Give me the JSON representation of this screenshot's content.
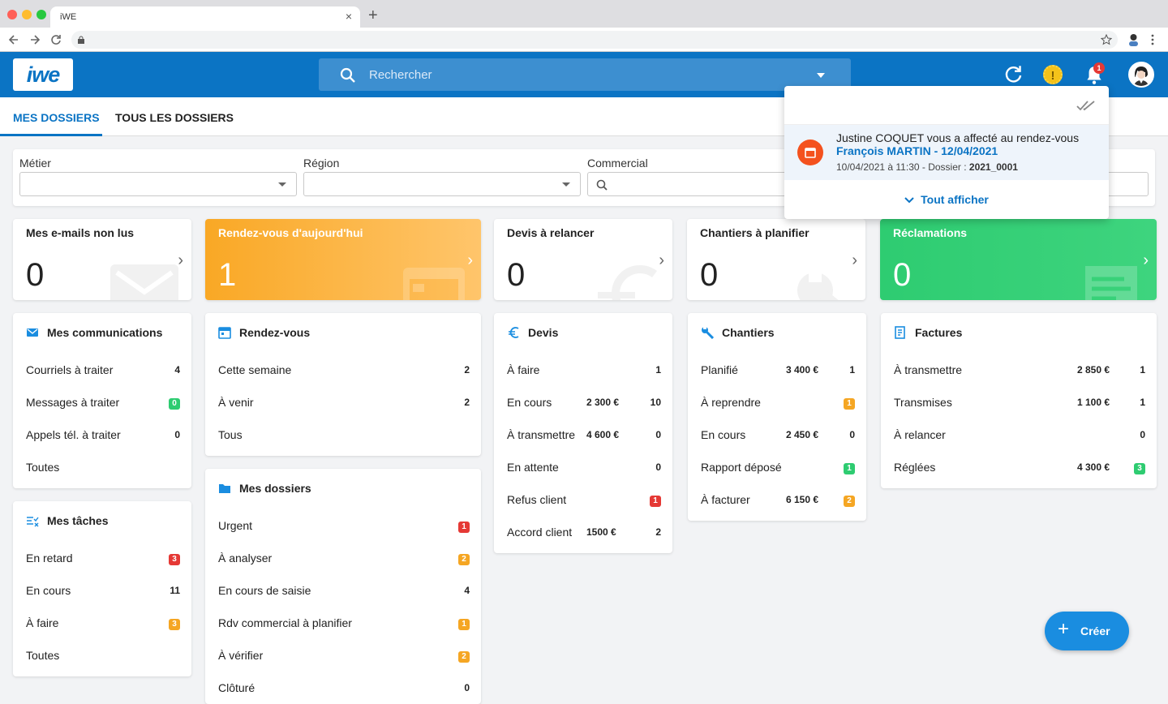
{
  "browser": {
    "tab_title": "iWE",
    "tab_close": "×",
    "new_tab": "+"
  },
  "app": {
    "logo": "iwe",
    "search_placeholder": "Rechercher",
    "warning_symbol": "!",
    "notif_count": "1"
  },
  "nav_tabs": [
    "MES DOSSIERS",
    "TOUS LES DOSSIERS"
  ],
  "filters": {
    "metier": "Métier",
    "region": "Région",
    "commercial": "Commercial"
  },
  "kpis": [
    {
      "title": "Mes e-mails non lus",
      "value": "0",
      "color": "#ffffff",
      "icon": "envelope-icon"
    },
    {
      "title": "Rendez-vous d'aujourd'hui",
      "value": "1",
      "color": "#f9a825",
      "icon": "calendar-icon"
    },
    {
      "title": "Devis à relancer",
      "value": "0",
      "color": "#ffffff",
      "icon": "euro-icon"
    },
    {
      "title": "Chantiers à planifier",
      "value": "0",
      "color": "#ffffff",
      "icon": "wrench-icon"
    },
    {
      "title": "Réclamations",
      "value": "0",
      "color": "#2ecc71",
      "icon": "receipt-icon"
    }
  ],
  "communications": {
    "title": "Mes communications",
    "rows": [
      {
        "label": "Courriels à traiter",
        "count": "4",
        "badge": ""
      },
      {
        "label": "Messages à traiter",
        "count": "0",
        "badge": "green"
      },
      {
        "label": "Appels tél. à traiter",
        "count": "0",
        "badge": ""
      },
      {
        "label": "Toutes",
        "count": "",
        "badge": ""
      }
    ]
  },
  "taches": {
    "title": "Mes tâches",
    "rows": [
      {
        "label": "En retard",
        "count": "3",
        "badge": "red"
      },
      {
        "label": "En cours",
        "count": "11",
        "badge": ""
      },
      {
        "label": "À faire",
        "count": "3",
        "badge": "orange"
      },
      {
        "label": "Toutes",
        "count": "",
        "badge": ""
      }
    ]
  },
  "rendezvous": {
    "title": "Rendez-vous",
    "rows": [
      {
        "label": "Cette semaine",
        "count": "2",
        "badge": ""
      },
      {
        "label": "À venir",
        "count": "2",
        "badge": ""
      },
      {
        "label": "Tous",
        "count": "",
        "badge": ""
      }
    ]
  },
  "dossiers": {
    "title": "Mes dossiers",
    "rows": [
      {
        "label": "Urgent",
        "count": "1",
        "badge": "red"
      },
      {
        "label": "À analyser",
        "count": "2",
        "badge": "orange"
      },
      {
        "label": "En cours de saisie",
        "count": "4",
        "badge": ""
      },
      {
        "label": "Rdv commercial à planifier",
        "count": "1",
        "badge": "orange"
      },
      {
        "label": "À vérifier",
        "count": "2",
        "badge": "orange"
      },
      {
        "label": "Clôturé",
        "count": "0",
        "badge": ""
      }
    ]
  },
  "devis": {
    "title": "Devis",
    "rows": [
      {
        "label": "À faire",
        "amount": "",
        "count": "1",
        "badge": ""
      },
      {
        "label": "En cours",
        "amount": "2 300 €",
        "count": "10",
        "badge": ""
      },
      {
        "label": "À transmettre",
        "amount": "4 600 €",
        "count": "0",
        "badge": ""
      },
      {
        "label": "En attente",
        "amount": "",
        "count": "0",
        "badge": ""
      },
      {
        "label": "Refus client",
        "amount": "",
        "count": "1",
        "badge": "red"
      },
      {
        "label": "Accord client",
        "amount": "1500 €",
        "count": "2",
        "badge": ""
      }
    ]
  },
  "chantiers": {
    "title": "Chantiers",
    "rows": [
      {
        "label": "Planifié",
        "amount": "3 400 €",
        "count": "1",
        "badge": ""
      },
      {
        "label": "À reprendre",
        "amount": "",
        "count": "1",
        "badge": "orange"
      },
      {
        "label": "En cours",
        "amount": "2 450 €",
        "count": "0",
        "badge": ""
      },
      {
        "label": "Rapport déposé",
        "amount": "",
        "count": "1",
        "badge": "green"
      },
      {
        "label": "À facturer",
        "amount": "6 150 €",
        "count": "2",
        "badge": "orange"
      }
    ]
  },
  "factures": {
    "title": "Factures",
    "rows": [
      {
        "label": "À transmettre",
        "amount": "2 850 €",
        "count": "1",
        "badge": ""
      },
      {
        "label": "Transmises",
        "amount": "1 100 €",
        "count": "1",
        "badge": ""
      },
      {
        "label": "À relancer",
        "amount": "",
        "count": "0",
        "badge": ""
      },
      {
        "label": "Réglées",
        "amount": "4 300 €",
        "count": "3",
        "badge": "green"
      }
    ]
  },
  "notification": {
    "line1": "Justine COQUET vous a affecté au rendez-vous",
    "line2": "François MARTIN - 12/04/2021",
    "line3_prefix": "10/04/2021 à 11:30 - Dossier : ",
    "line3_dossier": "2021_0001",
    "show_all": "Tout afficher"
  },
  "fab": {
    "label": "Créer",
    "plus": "+"
  },
  "colors": {
    "primary": "#0b74c4",
    "red": "#e53935",
    "orange": "#f5a623",
    "green": "#2ecc71"
  }
}
